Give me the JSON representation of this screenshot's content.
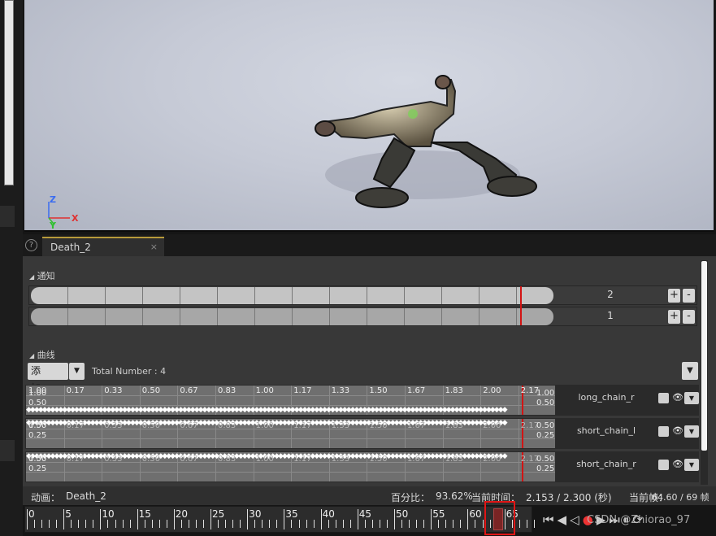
{
  "viewport": {
    "axis_z": "Z",
    "axis_y": "Y",
    "axis_x": "X"
  },
  "help_icon_label": "?",
  "tab": {
    "title": "Death_2",
    "close": "×"
  },
  "notify": {
    "header": "通知",
    "tracks": [
      {
        "value": "2",
        "plus": "+",
        "minus": "-"
      },
      {
        "value": "1",
        "plus": "+",
        "minus": "-"
      }
    ]
  },
  "curves_section": {
    "header": "曲线",
    "add_label": "添加......",
    "total_label": "Total Number : 4",
    "x_labels": [
      "1.00",
      "0.17",
      "0.33",
      "0.50",
      "0.67",
      "0.83",
      "1.00",
      "1.17",
      "1.33",
      "1.50",
      "1.67",
      "1.83",
      "2.00",
      "2.17"
    ],
    "curves": [
      {
        "name": "long_chain_r",
        "top_value": "1.00",
        "low_value": "0.50",
        "right_top": "1.00",
        "right_low": "0.50"
      },
      {
        "name": "short_chain_l",
        "top_value": "0.50",
        "low_value": "0.25",
        "right_top": "0.50",
        "right_low": "0.25"
      },
      {
        "name": "short_chain_r",
        "top_value": "0.50",
        "low_value": "0.25",
        "right_top": "0.50",
        "right_low": "0.25"
      }
    ]
  },
  "status": {
    "anim_label": "动画：",
    "anim_name": "Death_2",
    "percent_label": "百分比：",
    "percent_value": "93.62%",
    "time_label": "当前时间：",
    "time_value": "2.153 / 2.300 (秒)",
    "frame_label": "当前帧：",
    "frame_value": "64.60 / 69 帧"
  },
  "timeline": {
    "ticks": [
      "0",
      "5",
      "10",
      "15",
      "20",
      "25",
      "30",
      "35",
      "40",
      "45",
      "50",
      "55",
      "60",
      "65"
    ],
    "current_frame": 64.6,
    "total_frames": 69
  },
  "watermark": "CSDN @Zhiorao_97",
  "colors": {
    "playhead": "#d21414",
    "tab_accent": "#b89a3a"
  }
}
